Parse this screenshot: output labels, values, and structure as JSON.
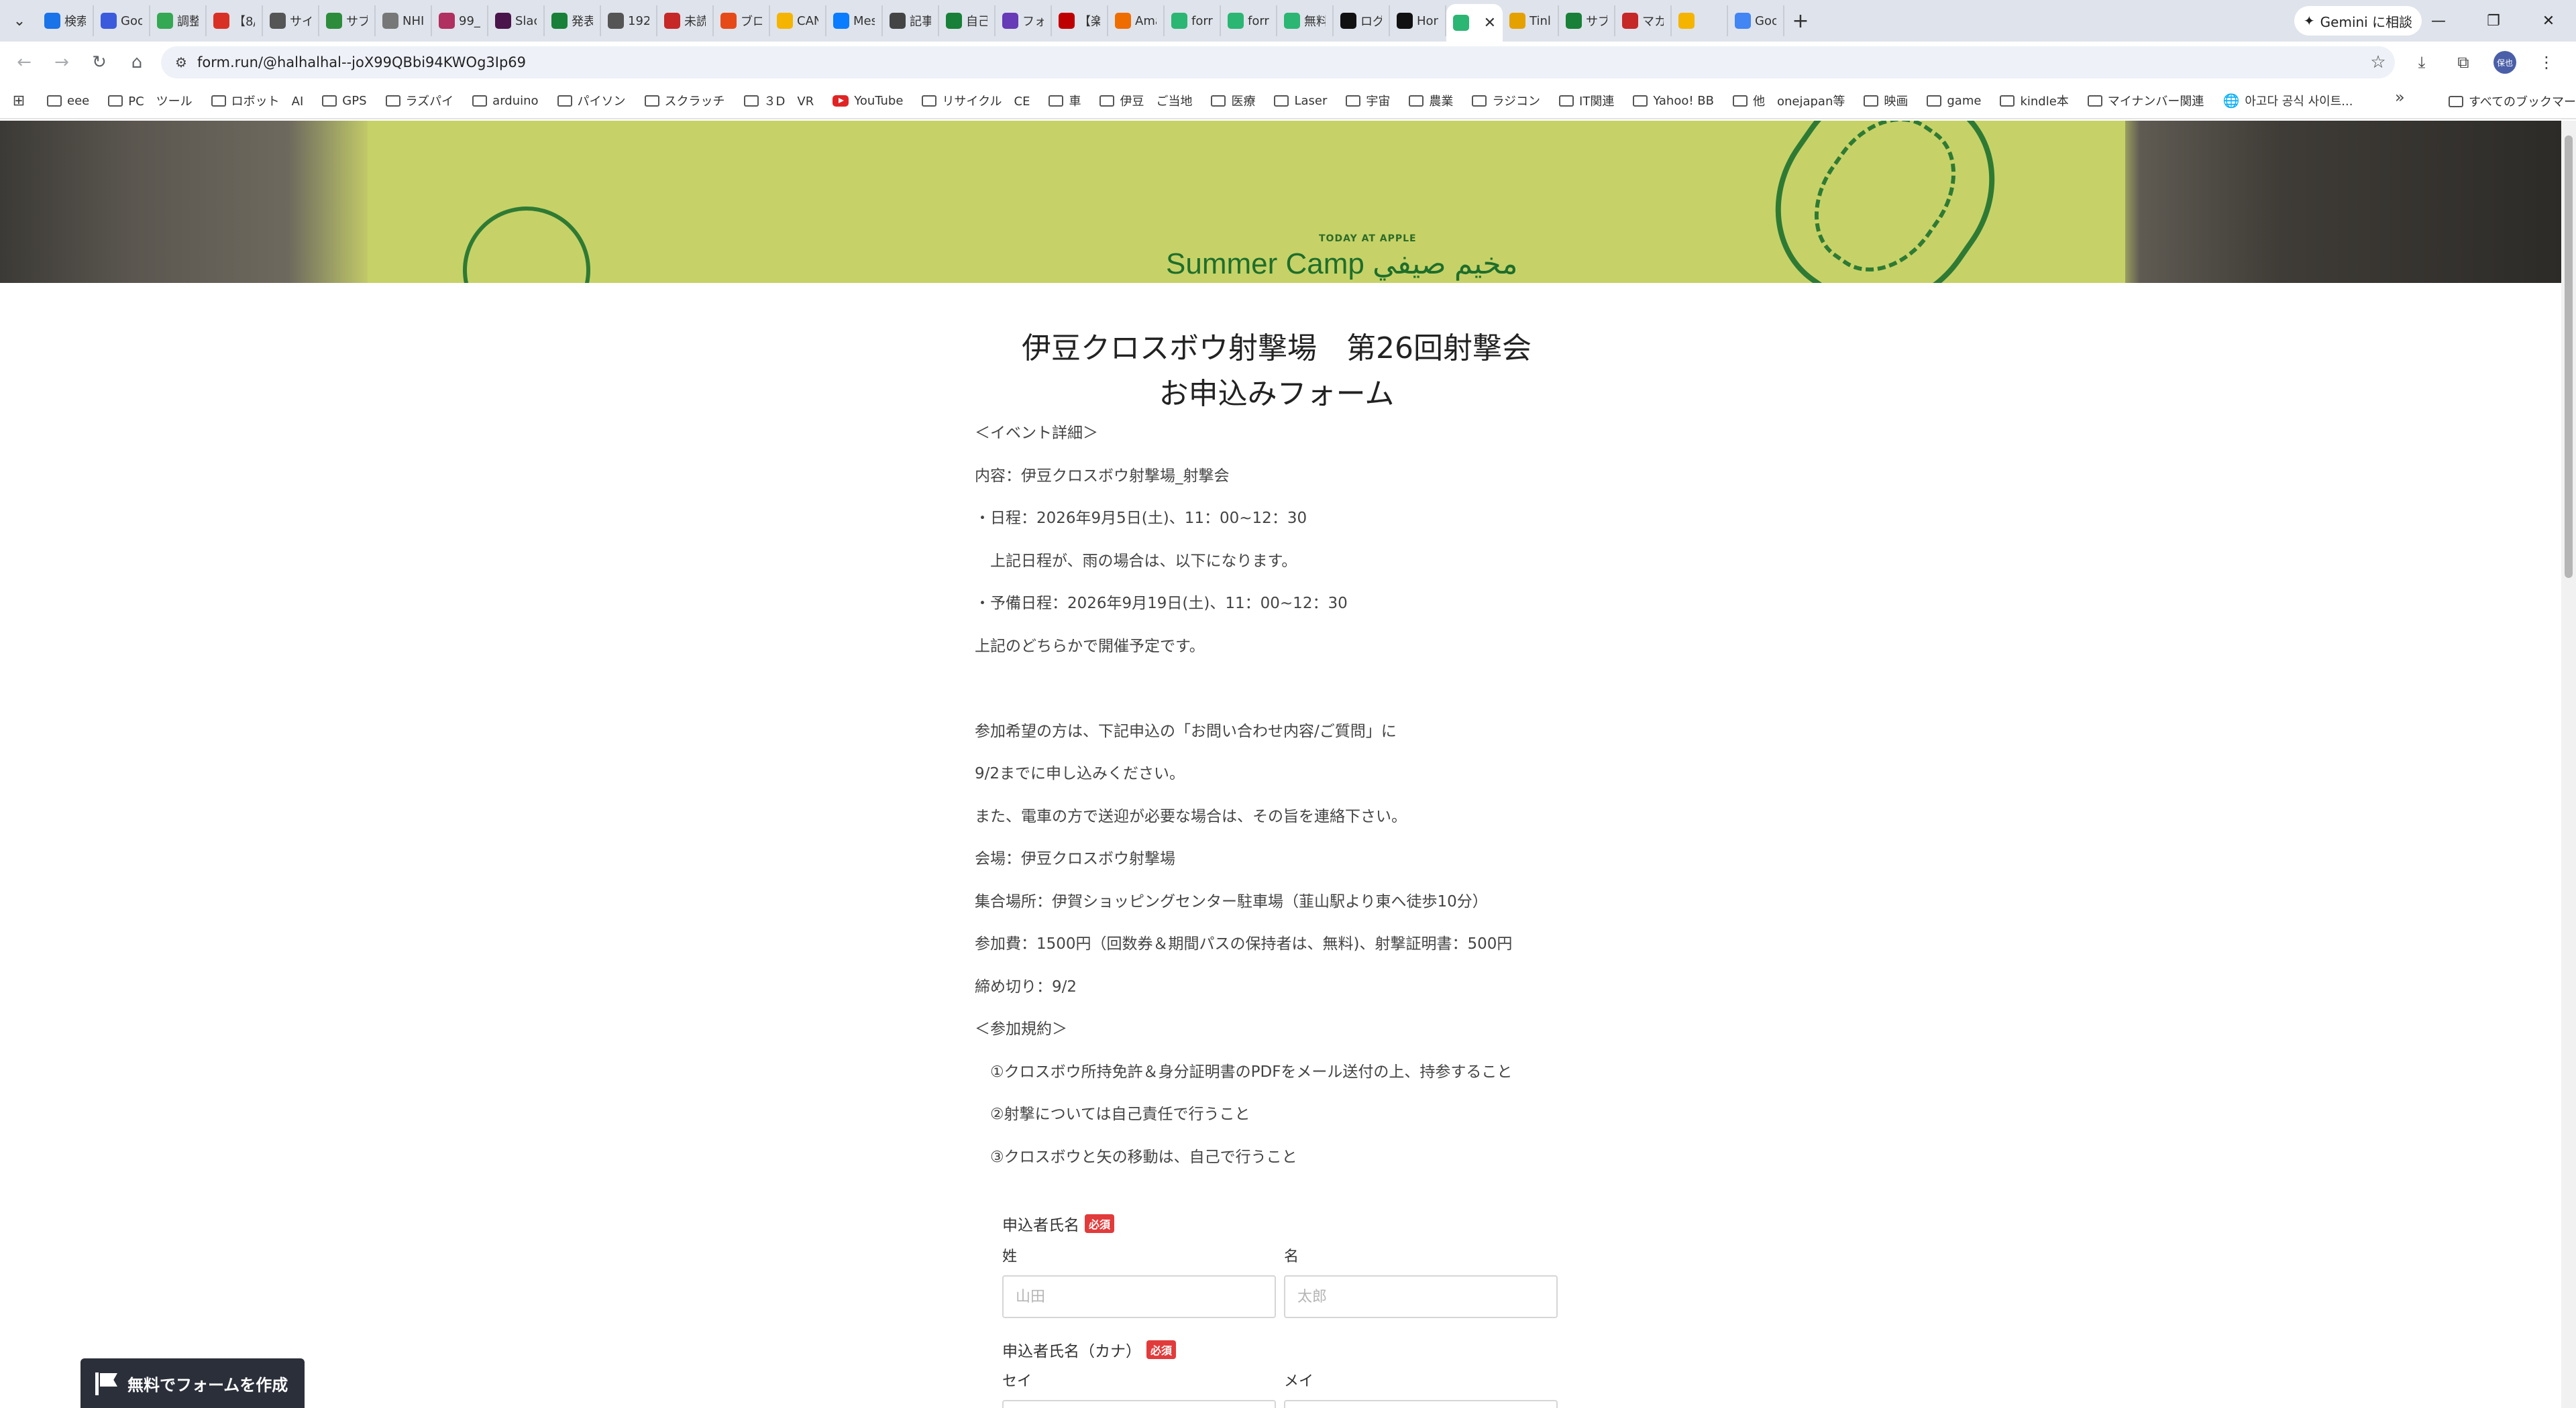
{
  "browser": {
    "tabs": [
      {
        "label": "検索",
        "icon": "search-icon",
        "color": "#1a73e8"
      },
      {
        "label": "Goo",
        "icon": "google-docs-icon",
        "color": "#3c5bdc"
      },
      {
        "label": "調整",
        "icon": "schedule-icon",
        "color": "#34a853"
      },
      {
        "label": "【8/(",
        "icon": "gmail-icon",
        "color": "#d93025"
      },
      {
        "label": "サイ",
        "icon": "globe-icon",
        "color": "#555555"
      },
      {
        "label": "サブ",
        "icon": "ssl-icon",
        "color": "#2c8c3c"
      },
      {
        "label": "NHI",
        "icon": "nhk-icon",
        "color": "#777777"
      },
      {
        "label": "99_",
        "icon": "sheet-icon",
        "color": "#b03060"
      },
      {
        "label": "Slac",
        "icon": "slack-icon",
        "color": "#4a154b"
      },
      {
        "label": "発表",
        "icon": "drive-icon",
        "color": "#188038"
      },
      {
        "label": "192",
        "icon": "globe-icon",
        "color": "#555555"
      },
      {
        "label": "未読",
        "icon": "mail-icon",
        "color": "#c62828"
      },
      {
        "label": "ブロ",
        "icon": "blog-icon",
        "color": "#e64a19"
      },
      {
        "label": "CAN",
        "icon": "canva-icon",
        "color": "#f4b400"
      },
      {
        "label": "Mes",
        "icon": "messenger-icon",
        "color": "#0a7cff"
      },
      {
        "label": "記事",
        "icon": "note-icon",
        "color": "#444444"
      },
      {
        "label": "自己",
        "icon": "drive-icon",
        "color": "#188038"
      },
      {
        "label": "フォ",
        "icon": "forms-icon",
        "color": "#673ab7"
      },
      {
        "label": "【楽",
        "icon": "rakuten-icon",
        "color": "#bf0000"
      },
      {
        "label": "Ama",
        "icon": "mail-icon",
        "color": "#ef6c00"
      },
      {
        "label": "forr",
        "icon": "formrun-icon",
        "color": "#2bb673"
      },
      {
        "label": "forr",
        "icon": "formrun-icon",
        "color": "#2bb673"
      },
      {
        "label": "無料",
        "icon": "formrun-icon",
        "color": "#2bb673"
      },
      {
        "label": "ログ",
        "icon": "tiktok-icon",
        "color": "#111111"
      },
      {
        "label": "Hon",
        "icon": "tiktok-icon",
        "color": "#111111"
      }
    ],
    "active_tab": {
      "icon": "formrun-icon",
      "color": "#2bb673"
    },
    "tabs_after": [
      {
        "label": "Tinl",
        "icon": "tinker-icon",
        "color": "#e5a100"
      },
      {
        "label": "サブ",
        "icon": "sheet-icon",
        "color": "#188038"
      },
      {
        "label": "マカ",
        "icon": "shield-icon",
        "color": "#c62828"
      },
      {
        "label": "",
        "icon": "camera-icon",
        "color": "#f4b400"
      },
      {
        "label": "Goo",
        "icon": "google-icon",
        "color": "#4285f4"
      }
    ],
    "gemini_label": "Gemini に相談",
    "url": "form.run/@halhalhal--joX99QBbi94KWOg3Ip69",
    "avatar_label": "保也"
  },
  "bookmarks": [
    {
      "label": "eee",
      "icon": "folder-icon"
    },
    {
      "label": "PC　ツール",
      "icon": "folder-icon"
    },
    {
      "label": "ロボット　AI",
      "icon": "folder-icon"
    },
    {
      "label": "GPS",
      "icon": "folder-icon"
    },
    {
      "label": "ラズパイ",
      "icon": "folder-icon"
    },
    {
      "label": "arduino",
      "icon": "folder-icon"
    },
    {
      "label": "パイソン",
      "icon": "folder-icon"
    },
    {
      "label": "スクラッチ",
      "icon": "folder-icon"
    },
    {
      "label": "３D　VR",
      "icon": "folder-icon"
    },
    {
      "label": "YouTube",
      "icon": "youtube-icon"
    },
    {
      "label": "リサイクル　CE",
      "icon": "folder-icon"
    },
    {
      "label": "車",
      "icon": "folder-icon"
    },
    {
      "label": "伊豆　ご当地",
      "icon": "folder-icon"
    },
    {
      "label": "医療",
      "icon": "folder-icon"
    },
    {
      "label": "Laser",
      "icon": "folder-icon"
    },
    {
      "label": "宇宙",
      "icon": "folder-icon"
    },
    {
      "label": "農業",
      "icon": "folder-icon"
    },
    {
      "label": "ラジコン",
      "icon": "folder-icon"
    },
    {
      "label": "IT関連",
      "icon": "folder-icon"
    },
    {
      "label": "Yahoo! BB",
      "icon": "folder-icon"
    },
    {
      "label": "他　onejapan等",
      "icon": "folder-icon"
    },
    {
      "label": "映画",
      "icon": "folder-icon"
    },
    {
      "label": "game",
      "icon": "folder-icon"
    },
    {
      "label": "kindle本",
      "icon": "folder-icon"
    },
    {
      "label": "マイナンバー関連",
      "icon": "folder-icon"
    },
    {
      "label": "아고다 공식 사이트...",
      "icon": "globe-icon"
    }
  ],
  "all_bookmarks_label": "すべてのブックマーク",
  "banner": {
    "today_label": "TODAY AT APPLE",
    "camp_label": "Summer Camp  مخيم صيفي"
  },
  "form": {
    "title_line1": "伊豆クロスボウ射撃場　第26回射撃会",
    "title_line2": "お申込みフォーム",
    "description": [
      "＜イベント詳細＞",
      "内容：伊豆クロスボウ射撃場_射撃会",
      "・日程：2026年9月5日(土)、11：00~12：30",
      "　上記日程が、雨の場合は、以下になります。",
      "・予備日程：2026年9月19日(土)、11：00~12：30",
      "上記のどちらかで開催予定です。",
      "",
      "参加希望の方は、下記申込の「お問い合わせ内容/ご質問」に",
      "9/2までに申し込みください。",
      "また、電車の方で送迎が必要な場合は、その旨を連絡下さい。",
      "会場：伊豆クロスボウ射撃場",
      "集合場所：伊賀ショッピングセンター駐車場（韮山駅より東へ徒歩10分）",
      "参加費：1500円（回数券＆期間パスの保持者は、無料)、射撃証明書：500円",
      "締め切り：9/2",
      "＜参加規約＞",
      "　①クロスボウ所持免許＆身分証明書のPDFをメール送付の上、持参すること",
      "　②射撃については自己責任で行うこと",
      "　③クロスボウと矢の移動は、自己で行うこと"
    ],
    "name_field": {
      "label": "申込者氏名",
      "required_badge": "必須",
      "last_label": "姓",
      "last_placeholder": "山田",
      "first_label": "名",
      "first_placeholder": "太郎"
    },
    "kana_field": {
      "label": "申込者氏名（カナ）",
      "required_badge": "必須",
      "last_label": "セイ",
      "first_label": "メイ"
    }
  },
  "make_form_button": "無料でフォームを作成"
}
